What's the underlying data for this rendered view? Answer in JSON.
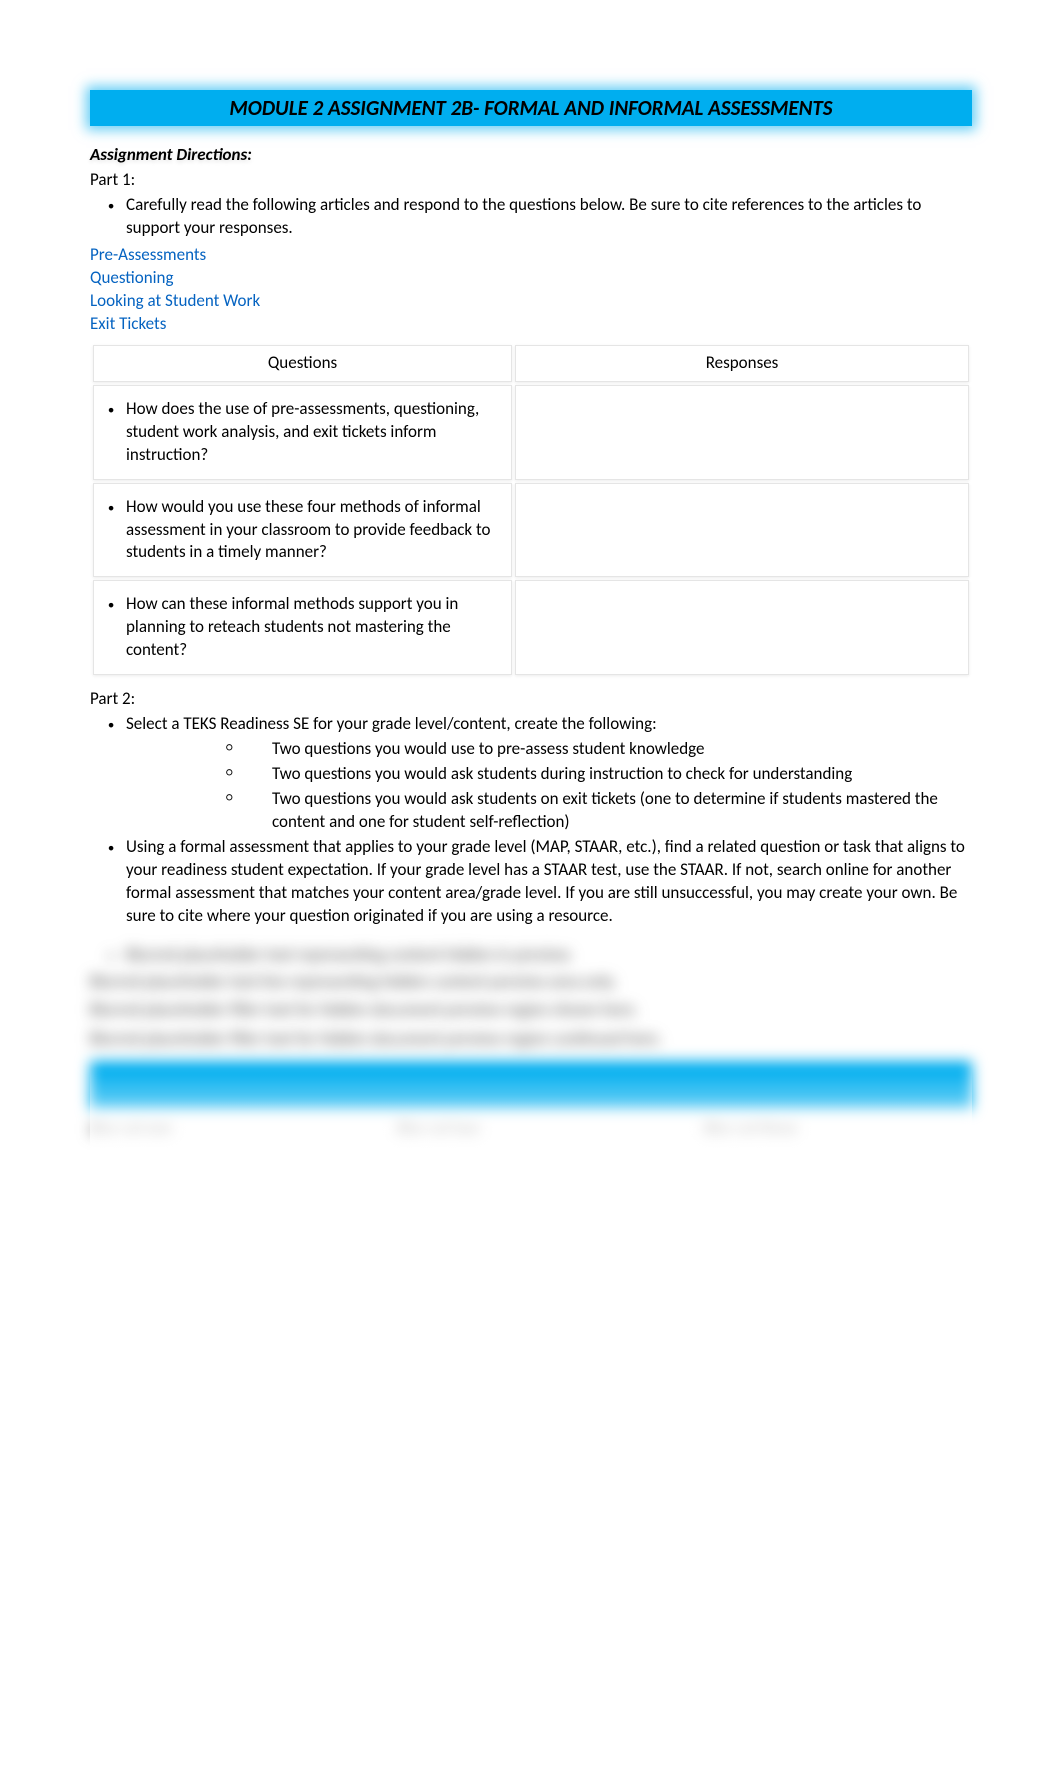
{
  "title": "MODULE 2 ASSIGNMENT 2B- FORMAL AND INFORMAL ASSESSMENTS",
  "directions_label": "Assignment Directions:",
  "part1": {
    "label": "Part 1:",
    "bullet": "Carefully read the following articles and respond to the questions below. Be sure to cite references to the articles to support your responses.",
    "links": [
      "Pre-Assessments",
      "Questioning",
      "Looking at Student Work",
      "Exit Tickets"
    ],
    "table": {
      "header_q": "Questions",
      "header_r": "Responses",
      "rows": [
        {
          "q": "How does the use of pre-assessments, questioning, student work analysis, and exit tickets inform instruction?",
          "r": ""
        },
        {
          "q": "How would you use these four methods of informal assessment in your classroom to provide feedback to students in a timely manner?",
          "r": ""
        },
        {
          "q": "How can these informal methods support you in planning to reteach students not mastering the content?",
          "r": ""
        }
      ]
    }
  },
  "part2": {
    "label": "Part 2:",
    "bullet1": "Select a TEKS Readiness SE for your grade level/content, create the following:",
    "subs": [
      "Two questions you would use to pre-assess student knowledge",
      "Two questions you would ask students during instruction to check for understanding",
      "Two questions you would ask students on exit tickets (one to determine if students mastered the content and one for student self-reflection)"
    ],
    "bullet2": "Using a formal assessment that applies to your grade level (MAP, STAAR, etc.), find a related question or task that aligns to your readiness student expectation. If your grade level has a STAAR test, use the STAAR. If not, search online for another formal assessment that matches your content area/grade level. If you are still unsuccessful, you may create your own. Be sure to cite where your question originated if you are using a resource."
  },
  "blurred": {
    "line1": "Blurred placeholder text representing content hidden in preview.",
    "line2": "Blurred placeholder text line representing hidden content preview area only.",
    "line3": "Blurred placeholder filler text for hidden document preview region shown here.",
    "line4": "Blurred placeholder filler text for hidden document preview region continued here.",
    "cell1": "Blur col one",
    "cell2": "Blur col two",
    "cell3": "Blur col three"
  }
}
